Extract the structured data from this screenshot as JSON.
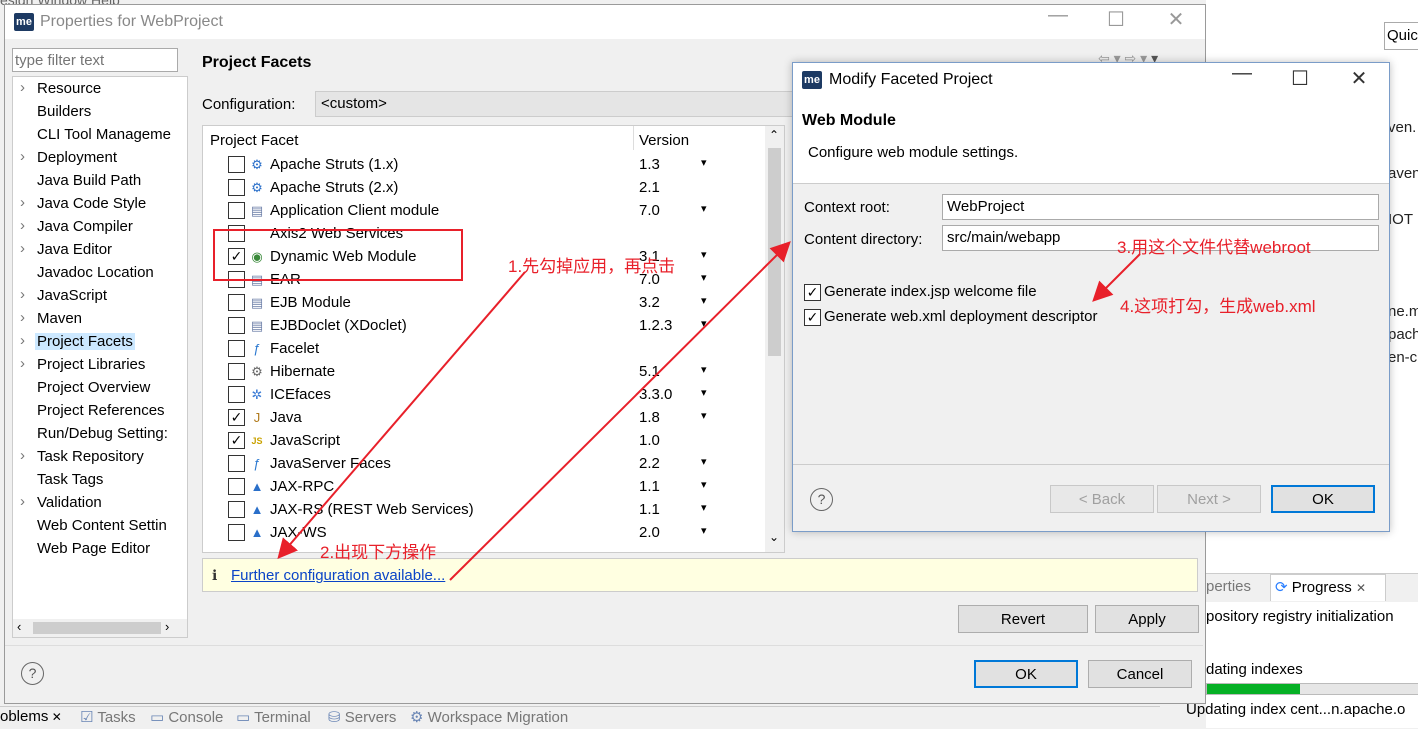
{
  "background": {
    "menu": "esign   Window   Help",
    "right_partial": {
      "quick": "Quic",
      "lines": [
        "ven.",
        "aven",
        "IOT",
        "ne.m",
        "pach",
        "en-c"
      ]
    },
    "progress_tabs": {
      "properties": "perties",
      "progress": "Progress"
    },
    "progress_items": [
      "pository registry initialization",
      "dating indexes",
      "Updating index cent...n.apache.o"
    ],
    "bottom_tabs": [
      "oblems",
      "Tasks",
      "Console",
      "Terminal",
      "Servers",
      "Workspace Migration"
    ]
  },
  "properties_dialog": {
    "title": "Properties for WebProject",
    "filter_placeholder": "type filter text",
    "tree": [
      {
        "label": "Resource",
        "expandable": true
      },
      {
        "label": "Builders",
        "expandable": false
      },
      {
        "label": "CLI Tool Manageme",
        "expandable": false
      },
      {
        "label": "Deployment",
        "expandable": true
      },
      {
        "label": "Java Build Path",
        "expandable": false
      },
      {
        "label": "Java Code Style",
        "expandable": true
      },
      {
        "label": "Java Compiler",
        "expandable": true
      },
      {
        "label": "Java Editor",
        "expandable": true
      },
      {
        "label": "Javadoc Location",
        "expandable": false
      },
      {
        "label": "JavaScript",
        "expandable": true
      },
      {
        "label": "Maven",
        "expandable": true
      },
      {
        "label": "Project Facets",
        "expandable": true,
        "selected": true
      },
      {
        "label": "Project Libraries",
        "expandable": true
      },
      {
        "label": "Project Overview",
        "expandable": false
      },
      {
        "label": "Project References",
        "expandable": false
      },
      {
        "label": "Run/Debug Setting:",
        "expandable": false
      },
      {
        "label": "Task Repository",
        "expandable": true
      },
      {
        "label": "Task Tags",
        "expandable": false
      },
      {
        "label": "Validation",
        "expandable": true
      },
      {
        "label": "Web Content Settin",
        "expandable": false
      },
      {
        "label": "Web Page Editor",
        "expandable": false
      }
    ],
    "page_title": "Project Facets",
    "configuration_label": "Configuration:",
    "configuration_value": "<custom>",
    "facet_header": "Project Facet",
    "version_header": "Version",
    "facets": [
      {
        "name": "Apache Struts (1.x)",
        "version": "1.3",
        "checked": false,
        "dropdown": true,
        "icon": "gear"
      },
      {
        "name": "Apache Struts (2.x)",
        "version": "2.1",
        "checked": false,
        "dropdown": false,
        "icon": "gear"
      },
      {
        "name": "Application Client module",
        "version": "7.0",
        "checked": false,
        "dropdown": true,
        "icon": "doc"
      },
      {
        "name": "Axis2 Web Services",
        "version": "",
        "checked": false,
        "dropdown": false,
        "icon": "none"
      },
      {
        "name": "Dynamic Web Module",
        "version": "3.1",
        "checked": true,
        "dropdown": true,
        "icon": "globe"
      },
      {
        "name": "EAR",
        "version": "7.0",
        "checked": false,
        "dropdown": true,
        "icon": "doc"
      },
      {
        "name": "EJB Module",
        "version": "3.2",
        "checked": false,
        "dropdown": true,
        "icon": "doc"
      },
      {
        "name": "EJBDoclet (XDoclet)",
        "version": "1.2.3",
        "checked": false,
        "dropdown": true,
        "icon": "doc"
      },
      {
        "name": "Facelet",
        "version": "",
        "checked": false,
        "dropdown": false,
        "icon": "f"
      },
      {
        "name": "Hibernate",
        "version": "5.1",
        "checked": false,
        "dropdown": true,
        "icon": "gear2"
      },
      {
        "name": "ICEfaces",
        "version": "3.3.0",
        "checked": false,
        "dropdown": true,
        "icon": "ice"
      },
      {
        "name": "Java",
        "version": "1.8",
        "checked": true,
        "dropdown": true,
        "icon": "java"
      },
      {
        "name": "JavaScript",
        "version": "1.0",
        "checked": true,
        "dropdown": false,
        "icon": "js"
      },
      {
        "name": "JavaServer Faces",
        "version": "2.2",
        "checked": false,
        "dropdown": true,
        "icon": "f"
      },
      {
        "name": "JAX-RPC",
        "version": "1.1",
        "checked": false,
        "dropdown": true,
        "icon": "tri"
      },
      {
        "name": "JAX-RS (REST Web Services)",
        "version": "1.1",
        "checked": false,
        "dropdown": true,
        "icon": "tri"
      },
      {
        "name": "JAX-WS",
        "version": "2.0",
        "checked": false,
        "dropdown": true,
        "icon": "tri"
      }
    ],
    "info_link": "Further configuration available...",
    "revert": "Revert",
    "apply": "Apply",
    "ok": "OK",
    "cancel": "Cancel"
  },
  "modify_dialog": {
    "title": "Modify Faceted Project",
    "heading": "Web Module",
    "description": "Configure web module settings.",
    "context_root_label": "Context root:",
    "context_root_value": "WebProject",
    "content_dir_label": "Content directory:",
    "content_dir_value": "src/main/webapp",
    "cb_welcome": "Generate index.jsp welcome file",
    "cb_descriptor": "Generate web.xml deployment descriptor",
    "back": "< Back",
    "next": "Next >",
    "ok": "OK"
  },
  "annotations": {
    "a1": "1.先勾掉应用，再点击",
    "a2": "2.出现下方操作",
    "a3": "3.用这个文件代替webroot",
    "a4": "4.这项打勾，生成web.xml"
  },
  "colors": {
    "annotation": "#e8202a",
    "selection": "#cce8ff",
    "accent": "#0078d7"
  }
}
